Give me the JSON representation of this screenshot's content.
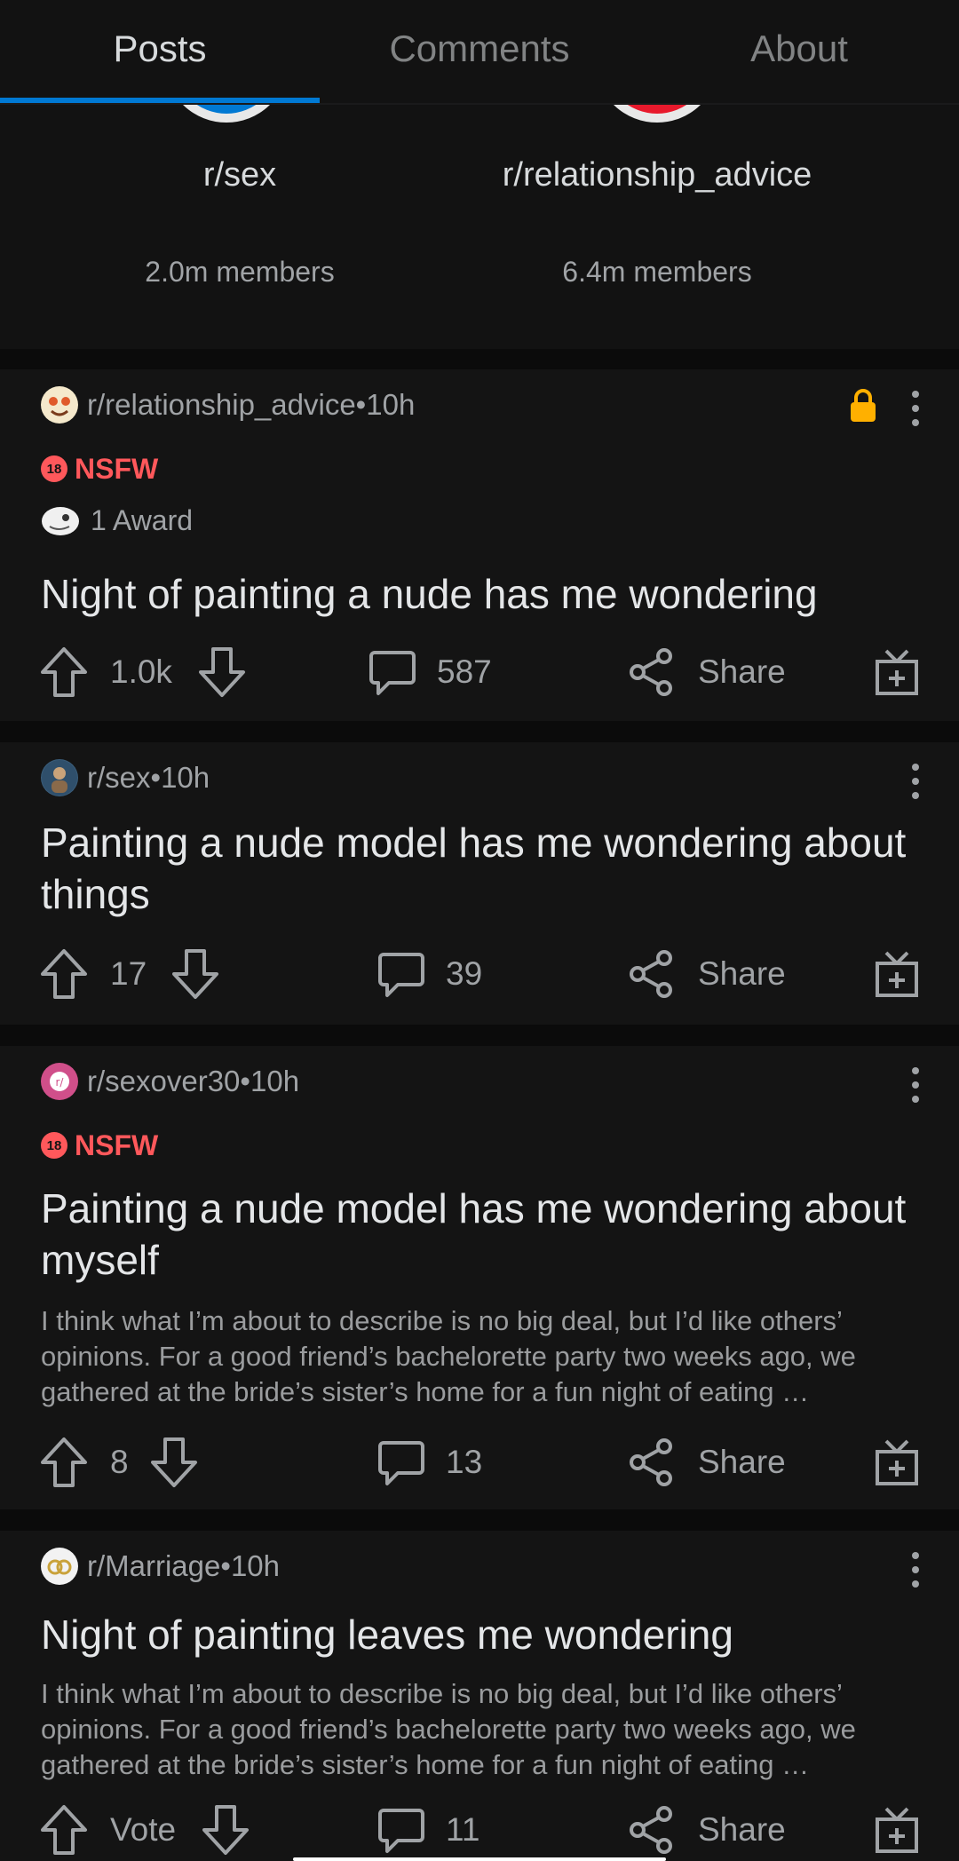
{
  "tabs": [
    {
      "label": "Posts",
      "active": true
    },
    {
      "label": "Comments",
      "active": false
    },
    {
      "label": "About",
      "active": false
    }
  ],
  "communities": [
    {
      "name": "r/sex",
      "members": "2.0m members",
      "color": "#0079d3"
    },
    {
      "name": "r/relationship_advice",
      "members": "6.4m members",
      "color": "#e8192c"
    }
  ],
  "posts": [
    {
      "subreddit": "r/relationship_advice",
      "separator": " • ",
      "time": "10h",
      "locked": true,
      "nsfw_label": "NSFW",
      "nsfw_badge": "18",
      "award": "1 Award",
      "title": "Night of painting a nude has me wondering",
      "votes": "1.0k",
      "comments": "587",
      "share": "Share"
    },
    {
      "subreddit": "r/sex",
      "separator": " • ",
      "time": "10h",
      "title": "Painting a nude model has me wondering about things",
      "votes": "17",
      "comments": "39",
      "share": "Share"
    },
    {
      "subreddit": "r/sexover30",
      "separator": " • ",
      "time": "10h",
      "nsfw_label": "NSFW",
      "nsfw_badge": "18",
      "title": "Painting a nude model has me wondering about myself",
      "body": "I think what I’m about to describe is no big deal, but I’d like others’ opinions.  For a good friend’s bachelorette party two weeks ago, we gathered at the bride’s sister’s home for a fun night of eating …",
      "votes": "8",
      "comments": "13",
      "share": "Share"
    },
    {
      "subreddit": "r/Marriage",
      "separator": " • ",
      "time": "10h",
      "title": "Night of painting leaves me wondering",
      "body": "I think what I’m about to describe is no big deal, but I’d like others’ opinions.  For a good friend’s bachelorette party two weeks ago, we gathered at the bride’s sister’s home for a fun night of eating …",
      "votes": "Vote",
      "comments": "11",
      "share": "Share"
    }
  ],
  "icons": {
    "upvote": "arrow-up-icon",
    "downvote": "arrow-down-icon",
    "comment": "comment-bubble-icon",
    "share": "share-icon",
    "gift": "gift-award-icon",
    "lock": "lock-icon",
    "more": "more-vertical-icon"
  },
  "colors": {
    "accent": "#0079d3",
    "nsfw": "#ff585b",
    "lock": "#ffb000"
  }
}
